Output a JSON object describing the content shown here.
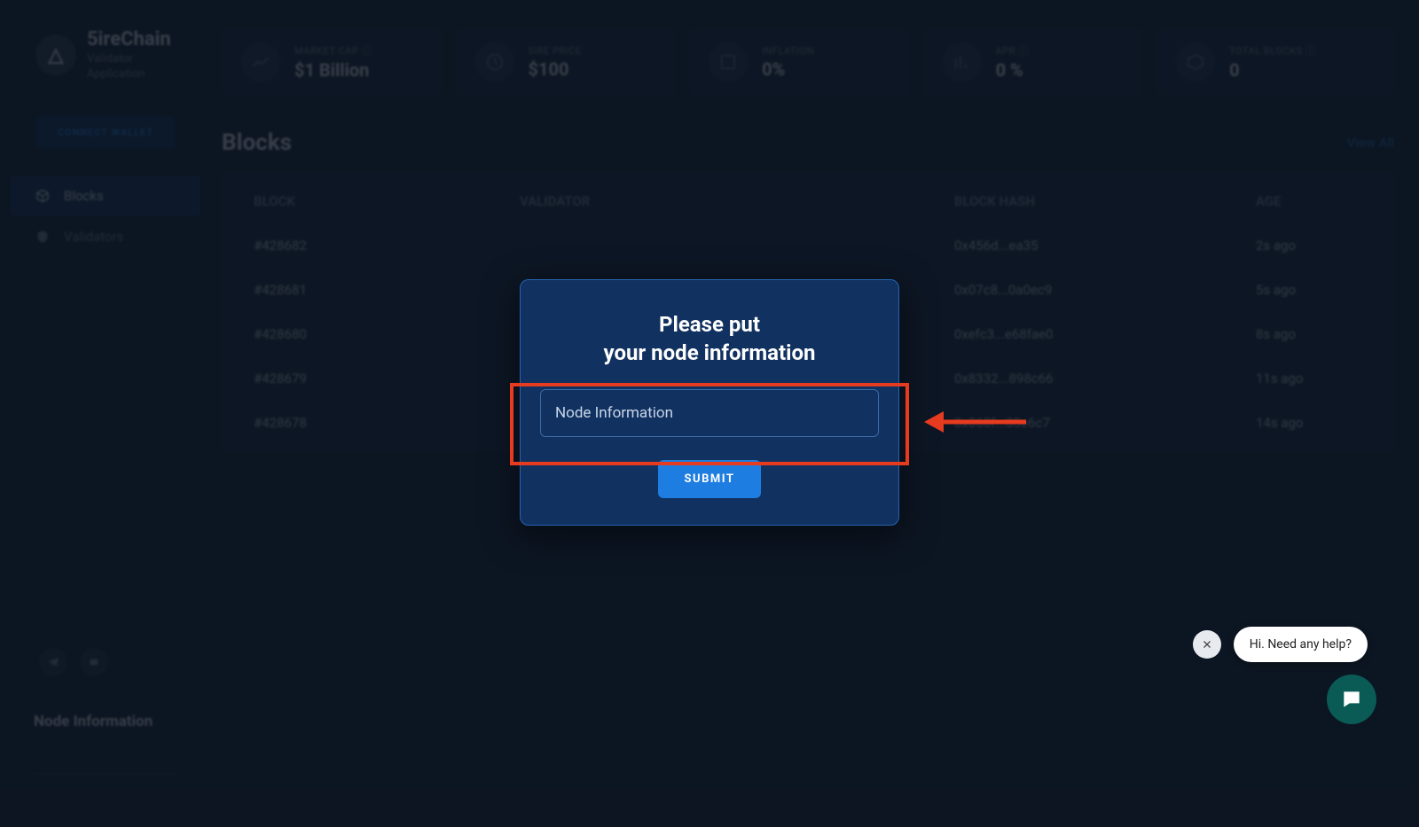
{
  "brand": {
    "name": "5ireChain",
    "subtitle": "Validator Application",
    "logo_letter": "△"
  },
  "connect_wallet": "CONNECT WALLET",
  "nav": {
    "blocks": "Blocks",
    "validators": "Validators"
  },
  "stats": [
    {
      "label": "MARKET CAP ⓘ",
      "value": "$1 Billion"
    },
    {
      "label": "5IRE PRICE",
      "value": "$100"
    },
    {
      "label": "INFLATION",
      "value": "0%"
    },
    {
      "label": "APR ⓘ",
      "value": "0 %"
    },
    {
      "label": "TOTAL BLOCKS ⓘ",
      "value": "0"
    }
  ],
  "blocks": {
    "title": "Blocks",
    "view_all": "View All",
    "columns": {
      "block": "BLOCK",
      "validator": "VALIDATOR",
      "hash": "BLOCK HASH",
      "age": "AGE"
    },
    "rows": [
      {
        "block": "#428682",
        "validator": "",
        "hash": "0x456d...ea35",
        "age": "2s ago"
      },
      {
        "block": "#428681",
        "validator": "",
        "hash": "0x07c8...0a0ec9",
        "age": "5s ago"
      },
      {
        "block": "#428680",
        "validator": "",
        "hash": "0xefc3...e68fae0",
        "age": "8s ago"
      },
      {
        "block": "#428679",
        "validator": "",
        "hash": "0x8332...898c66",
        "age": "11s ago"
      },
      {
        "block": "#428678",
        "validator": "",
        "hash": "0x060f...03e6c7",
        "age": "14s ago"
      }
    ]
  },
  "sidebar_node": {
    "heading": "Node Information",
    "placeholder": ""
  },
  "modal": {
    "line1": "Please put",
    "line2": "your node information",
    "placeholder": "Node Information",
    "submit": "SUBMIT"
  },
  "help": {
    "text": "Hi. Need any help?"
  }
}
